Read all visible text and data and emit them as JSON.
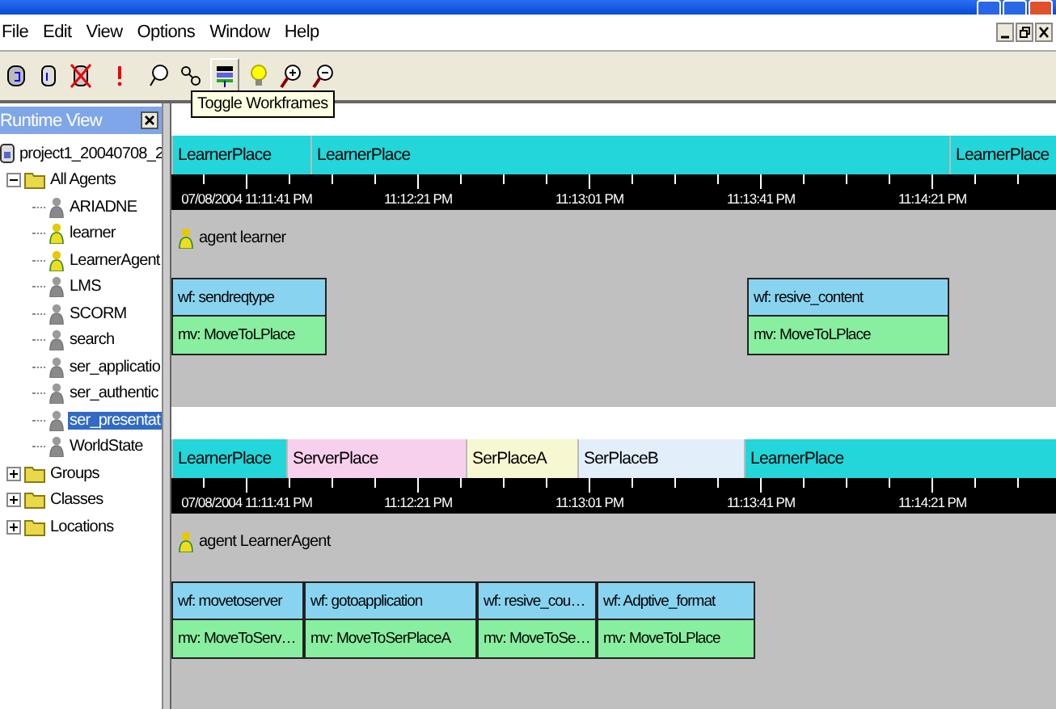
{
  "menu": [
    "File",
    "Edit",
    "View",
    "Options",
    "Window",
    "Help"
  ],
  "tooltip": "Toggle Workframes",
  "runtime_view": {
    "title": "Runtime View",
    "tree": [
      {
        "label": "project1_20040708_2",
        "kind": "project",
        "children": [
          {
            "label": "All Agents",
            "kind": "folder",
            "expanded": true,
            "children": [
              {
                "label": "ARIADNE",
                "kind": "agent",
                "active": false,
                "selected": false
              },
              {
                "label": "learner",
                "kind": "agent",
                "active": true,
                "selected": false
              },
              {
                "label": "LearnerAgent",
                "kind": "agent",
                "active": true,
                "selected": false
              },
              {
                "label": "LMS",
                "kind": "agent",
                "active": false,
                "selected": false
              },
              {
                "label": "SCORM",
                "kind": "agent",
                "active": false,
                "selected": false
              },
              {
                "label": "search",
                "kind": "agent",
                "active": false,
                "selected": false
              },
              {
                "label": "ser_applicatio",
                "kind": "agent",
                "active": false,
                "selected": false
              },
              {
                "label": "ser_authentic",
                "kind": "agent",
                "active": false,
                "selected": false
              },
              {
                "label": "ser_presentat",
                "kind": "agent",
                "active": false,
                "selected": true
              },
              {
                "label": "WorldState",
                "kind": "agent",
                "active": false,
                "selected": false
              }
            ]
          },
          {
            "label": "Groups",
            "kind": "folder",
            "expanded": false
          },
          {
            "label": "Classes",
            "kind": "folder",
            "expanded": false
          },
          {
            "label": "Locations",
            "kind": "folder",
            "expanded": false
          }
        ]
      }
    ]
  },
  "timelines": [
    {
      "places": [
        {
          "label": "LearnerPlace",
          "color": "#22d6da"
        },
        {
          "label": "LearnerPlace",
          "color": "#22d6da"
        },
        {
          "label": "LearnerPlace",
          "color": "#22d6da"
        }
      ],
      "ticks": [
        "07/08/2004 11:11:41 PM",
        "11:12:21 PM",
        "11:13:01 PM",
        "11:13:41 PM",
        "11:14:21 PM"
      ],
      "agent": "agent learner",
      "activities": [
        {
          "workframe": "wf: sendreqtype",
          "movement": "mv: MoveToLPlace"
        },
        {
          "workframe": "wf: resive_content",
          "movement": "mv: MoveToLPlace"
        }
      ]
    },
    {
      "places": [
        {
          "label": "LearnerPlace",
          "color": "#22d6da"
        },
        {
          "label": "ServerPlace",
          "color": "#f7d0ee"
        },
        {
          "label": "SerPlaceA",
          "color": "#f7f7d2"
        },
        {
          "label": "SerPlaceB",
          "color": "#e2eefa"
        },
        {
          "label": "LearnerPlace",
          "color": "#22d6da"
        }
      ],
      "ticks": [
        "07/08/2004 11:11:41 PM",
        "11:12:21 PM",
        "11:13:01 PM",
        "11:13:41 PM",
        "11:14:21 PM"
      ],
      "agent": "agent LearnerAgent",
      "activities": [
        {
          "workframe": "wf: movetoserver",
          "movement": "mv: MoveToServ…"
        },
        {
          "workframe": "wf: gotoapplication",
          "movement": "mv: MoveToSerPlaceA"
        },
        {
          "workframe": "wf: resive_cou…",
          "movement": "mv: MoveToSe…"
        },
        {
          "workframe": "wf: Adptive_format",
          "movement": "mv: MoveToLPlace"
        }
      ]
    }
  ]
}
